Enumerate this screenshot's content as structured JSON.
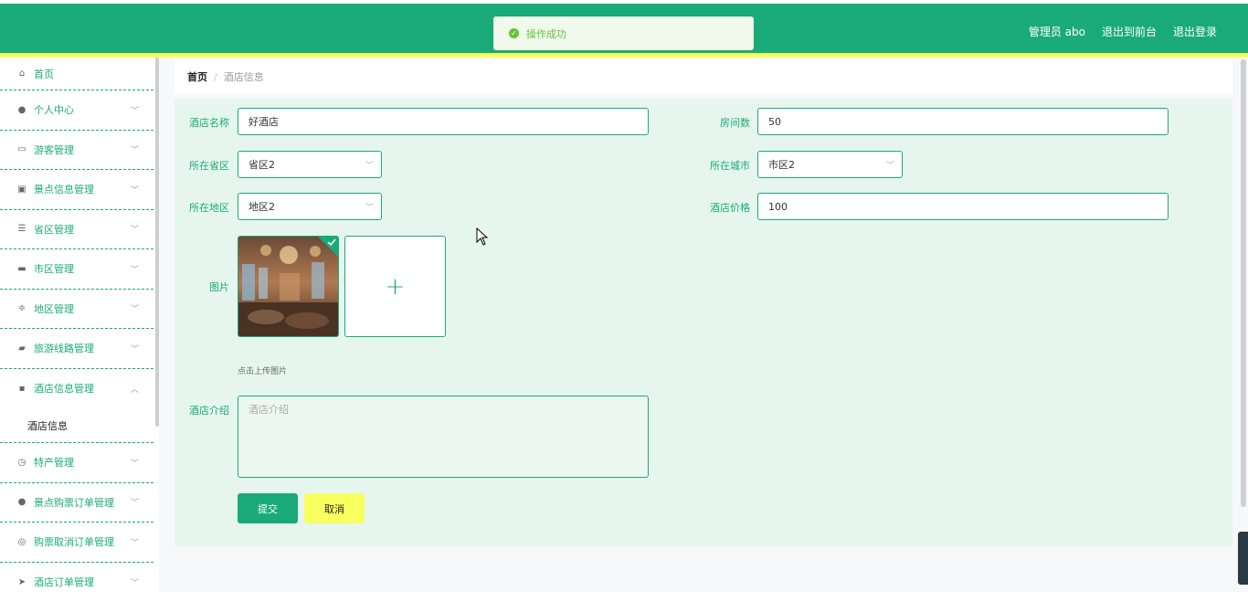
{
  "header": {
    "admin_label": "管理员 abo",
    "to_front_label": "退出到前台",
    "logout_label": "退出登录"
  },
  "toast": {
    "message": "操作成功"
  },
  "sidebar": {
    "items": [
      {
        "label": "首页",
        "icon": "home-icon"
      },
      {
        "label": "个人中心",
        "icon": "user-icon"
      },
      {
        "label": "游客管理",
        "icon": "id-card-icon"
      },
      {
        "label": "景点信息管理",
        "icon": "clipboard-icon"
      },
      {
        "label": "省区管理",
        "icon": "list-icon"
      },
      {
        "label": "市区管理",
        "icon": "monitor-icon"
      },
      {
        "label": "地区管理",
        "icon": "sliders-icon"
      },
      {
        "label": "旅游线路管理",
        "icon": "ticket-icon"
      },
      {
        "label": "酒店信息管理",
        "icon": "chat-icon"
      },
      {
        "label": "特产管理",
        "icon": "clock-icon"
      },
      {
        "label": "景点购票订单管理",
        "icon": "user-icon"
      },
      {
        "label": "购票取消订单管理",
        "icon": "crosshair-icon"
      },
      {
        "label": "酒店订单管理",
        "icon": "send-icon"
      }
    ],
    "active_sub": "酒店信息"
  },
  "breadcrumb": {
    "home": "首页",
    "separator": "/",
    "current": "酒店信息"
  },
  "form": {
    "hotel_name": {
      "label": "酒店名称",
      "value": "好酒店"
    },
    "room_count": {
      "label": "房间数",
      "value": "50"
    },
    "province": {
      "label": "所在省区",
      "value": "省区2"
    },
    "city": {
      "label": "所在城市",
      "value": "市区2"
    },
    "district": {
      "label": "所在地区",
      "value": "地区2"
    },
    "price": {
      "label": "酒店价格",
      "value": "100"
    },
    "image": {
      "label": "图片",
      "tip": "点击上传图片",
      "add_symbol": "+"
    },
    "intro": {
      "label": "酒店介绍",
      "placeholder": "酒店介绍"
    },
    "submit_label": "提交",
    "cancel_label": "取消"
  },
  "colors": {
    "primary": "#1aaa7a",
    "accent": "#f9ff5f",
    "panel": "#e6f6ef"
  }
}
